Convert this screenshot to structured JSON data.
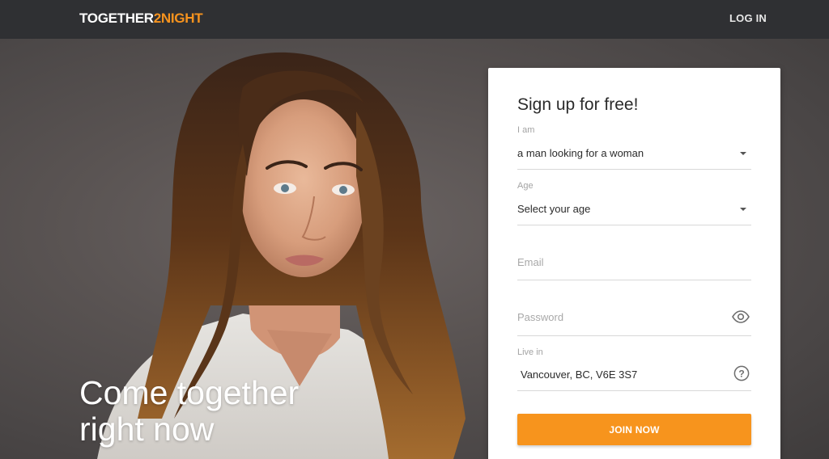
{
  "header": {
    "logo_part1": "TOGETHER",
    "logo_part2": "2NIGHT",
    "login_label": "LOG IN"
  },
  "hero": {
    "tagline_line1": "Come together",
    "tagline_line2": "right now",
    "photo_icon": "woman-portrait"
  },
  "signup": {
    "title": "Sign up for free!",
    "i_am_label": "I am",
    "i_am_value": "a man looking for a woman",
    "age_label": "Age",
    "age_value": "Select your age",
    "email_placeholder": "Email",
    "password_placeholder": "Password",
    "live_in_label": "Live in",
    "live_in_value": "Vancouver, BC, V6E 3S7",
    "join_label": "JOIN NOW"
  },
  "colors": {
    "accent": "#f7941d",
    "topbar": "#2f3033",
    "background": "#4a4747"
  }
}
